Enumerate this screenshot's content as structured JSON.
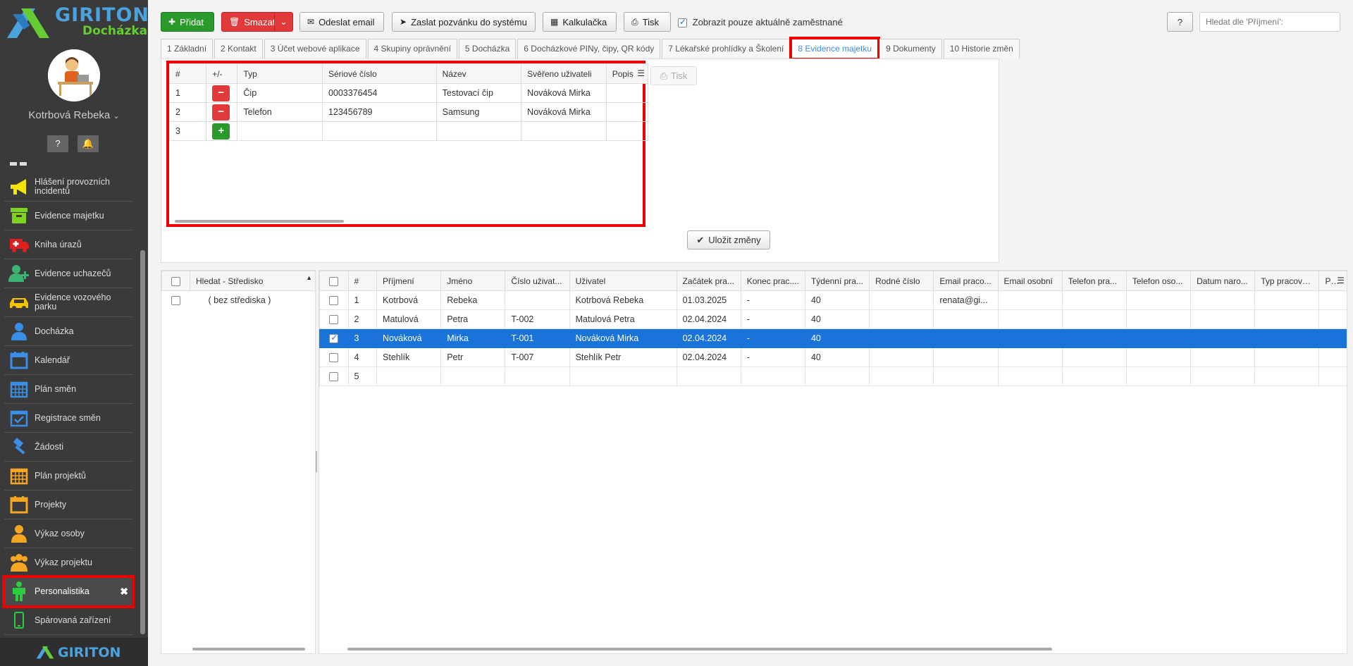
{
  "brand": {
    "name": "GIRITON",
    "product": "Docházka",
    "footer": "GIRITON"
  },
  "colors": {
    "accent": "#1a73d9",
    "green": "#2a9a2a",
    "red": "#e23a3a",
    "highlight": "#e00000"
  },
  "user": {
    "name": "Kotrbová Rebeka"
  },
  "sidebar": {
    "items": [
      {
        "label": "Hlášení provozních incidentů",
        "icon": "megaphone-icon",
        "color": "#f5e400"
      },
      {
        "label": "Evidence majetku",
        "icon": "box-icon",
        "color": "#7ed321"
      },
      {
        "label": "Kniha úrazů",
        "icon": "ambulance-icon",
        "color": "#e02020"
      },
      {
        "label": "Evidence uchazečů",
        "icon": "user-plus-icon",
        "color": "#3cb371"
      },
      {
        "label": "Evidence vozového parku",
        "icon": "car-icon",
        "color": "#f5c400"
      },
      {
        "label": "Docházka",
        "icon": "person-icon",
        "color": "#3a8ee6"
      },
      {
        "label": "Kalendář",
        "icon": "calendar-icon",
        "color": "#3a8ee6"
      },
      {
        "label": "Plán směn",
        "icon": "calendar-grid-icon",
        "color": "#3a8ee6"
      },
      {
        "label": "Registrace směn",
        "icon": "calendar-check-icon",
        "color": "#3a8ee6"
      },
      {
        "label": "Žádosti",
        "icon": "gavel-icon",
        "color": "#3a8ee6"
      },
      {
        "label": "Plán projektů",
        "icon": "calendar-grid-icon",
        "color": "#f5a623"
      },
      {
        "label": "Projekty",
        "icon": "calendar-icon",
        "color": "#f5a623"
      },
      {
        "label": "Výkaz osoby",
        "icon": "person-icon",
        "color": "#f5a623"
      },
      {
        "label": "Výkaz projektu",
        "icon": "group-icon",
        "color": "#f5a623"
      },
      {
        "label": "Personalistika",
        "icon": "person-standing-icon",
        "color": "#2ecc40"
      },
      {
        "label": "Spárovaná zařízení",
        "icon": "phone-icon",
        "color": "#2ecc40"
      }
    ]
  },
  "toolbar": {
    "add": "Přidat",
    "delete": "Smazat",
    "email": "Odeslat email",
    "invite": "Zaslat pozvánku do systému",
    "calc": "Kalkulačka",
    "print": "Tisk",
    "only_current": "Zobrazit pouze aktuálně zaměstnané",
    "help": "?",
    "search_placeholder": "Hledat dle 'Příjmení':"
  },
  "tabs": [
    "1 Základní",
    "2 Kontakt",
    "3 Účet webové aplikace",
    "4 Skupiny oprávnění",
    "5 Docházka",
    "6 Docházkové PINy, čipy, QR kódy",
    "7 Lékařské prohlídky a Školení",
    "8 Evidence majetku",
    "9 Dokumenty",
    "10 Historie změn"
  ],
  "asset_grid": {
    "headers": [
      "#",
      "+/-",
      "Typ",
      "Sériové číslo",
      "Název",
      "Svěřeno uživateli",
      "Popis"
    ],
    "rows": [
      {
        "n": "1",
        "typ": "Čip",
        "serial": "0003376454",
        "nazev": "Testovací čip",
        "user": "Nováková Mirka",
        "popis": ""
      },
      {
        "n": "2",
        "typ": "Telefon",
        "serial": "123456789",
        "nazev": "Samsung",
        "user": "Nováková Mirka",
        "popis": ""
      },
      {
        "n": "3",
        "typ": "",
        "serial": "",
        "nazev": "",
        "user": "",
        "popis": ""
      }
    ],
    "print": "Tisk",
    "save": "Uložit změny"
  },
  "centers": {
    "header": "Hledat - Středisko",
    "rows": [
      "( bez střediska )"
    ]
  },
  "employees": {
    "headers": [
      "#",
      "Příjmení",
      "Jméno",
      "Číslo uživat...",
      "Uživatel",
      "Začátek pra...",
      "Konec prac....",
      "Týdenní pra...",
      "Rodné číslo",
      "Email praco...",
      "Email osobní",
      "Telefon pra...",
      "Telefon oso...",
      "Datum naro...",
      "Typ pracovn...",
      "Po"
    ],
    "rows": [
      [
        "1",
        "Kotrbová",
        "Rebeka",
        "",
        "Kotrbová Rebeka",
        "01.03.2025",
        "-",
        "40",
        "",
        "renata@gi...",
        "",
        "",
        "",
        "",
        "",
        ""
      ],
      [
        "2",
        "Matulová",
        "Petra",
        "T-002",
        "Matulová Petra",
        "02.04.2024",
        "-",
        "40",
        "",
        "",
        "",
        "",
        "",
        "",
        "",
        ""
      ],
      [
        "3",
        "Nováková",
        "Mirka",
        "T-001",
        "Nováková Mirka",
        "02.04.2024",
        "-",
        "40",
        "",
        "",
        "",
        "",
        "",
        "",
        "",
        ""
      ],
      [
        "4",
        "Stehlík",
        "Petr",
        "T-007",
        "Stehlík Petr",
        "02.04.2024",
        "-",
        "40",
        "",
        "",
        "",
        "",
        "",
        "",
        "",
        ""
      ],
      [
        "5",
        "",
        "",
        "",
        "",
        "",
        "",
        "",
        "",
        "",
        "",
        "",
        "",
        "",
        "",
        ""
      ]
    ],
    "selected_row": 2
  }
}
